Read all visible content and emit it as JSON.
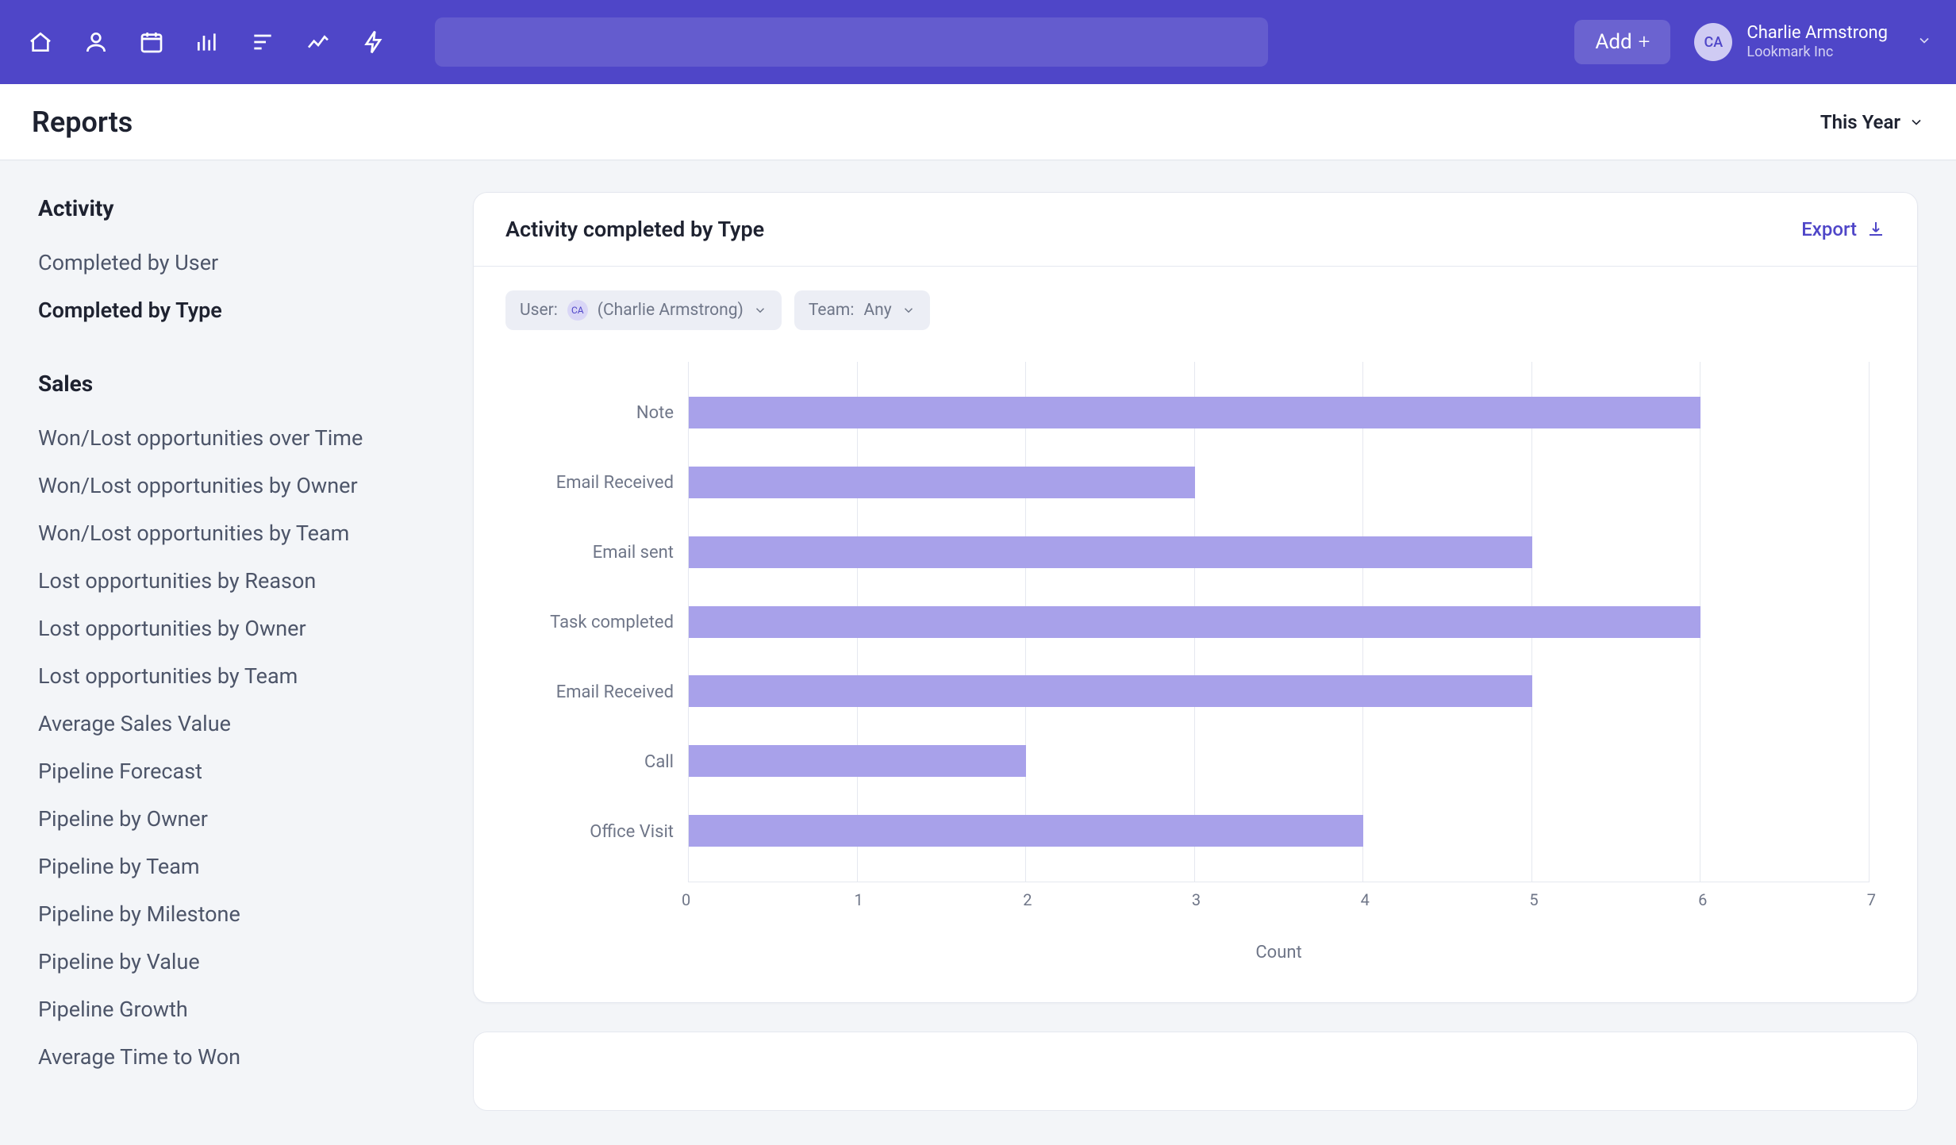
{
  "topnav": {
    "add_label": "Add",
    "user_initials": "CA",
    "user_name": "Charlie Armstrong",
    "user_org": "Lookmark Inc"
  },
  "page": {
    "title": "Reports",
    "time_filter_label": "This Year"
  },
  "sidebar": {
    "sections": [
      {
        "title": "Activity",
        "items": [
          "Completed by User",
          "Completed by Type"
        ],
        "active_index": 1
      },
      {
        "title": "Sales",
        "items": [
          "Won/Lost opportunities over Time",
          "Won/Lost opportunities by Owner",
          "Won/Lost opportunities by Team",
          "Lost opportunities by Reason",
          "Lost opportunities by Owner",
          "Lost opportunities by Team",
          "Average Sales Value",
          "Pipeline Forecast",
          "Pipeline by Owner",
          "Pipeline by Team",
          "Pipeline by Milestone",
          "Pipeline by Value",
          "Pipeline Growth",
          "Average Time to Won"
        ],
        "active_index": -1
      }
    ]
  },
  "card": {
    "title": "Activity completed by Type",
    "export_label": "Export",
    "filters": {
      "user_label": "User:",
      "user_value": "(Charlie Armstrong)",
      "user_initials": "CA",
      "team_label": "Team:",
      "team_value": "Any"
    }
  },
  "chart_data": {
    "type": "bar",
    "orientation": "horizontal",
    "categories": [
      "Note",
      "Email Received",
      "Email sent",
      "Task completed",
      "Email Received",
      "Call",
      "Office Visit"
    ],
    "values": [
      6,
      3,
      5,
      6,
      5,
      2,
      4
    ],
    "xlabel": "Count",
    "x_ticks": [
      0,
      1,
      2,
      3,
      4,
      5,
      6,
      7
    ],
    "xlim": [
      0,
      7
    ]
  },
  "colors": {
    "brand": "#4f46c8",
    "bar": "#a8a1ea",
    "accent_link": "#4f46c8"
  }
}
